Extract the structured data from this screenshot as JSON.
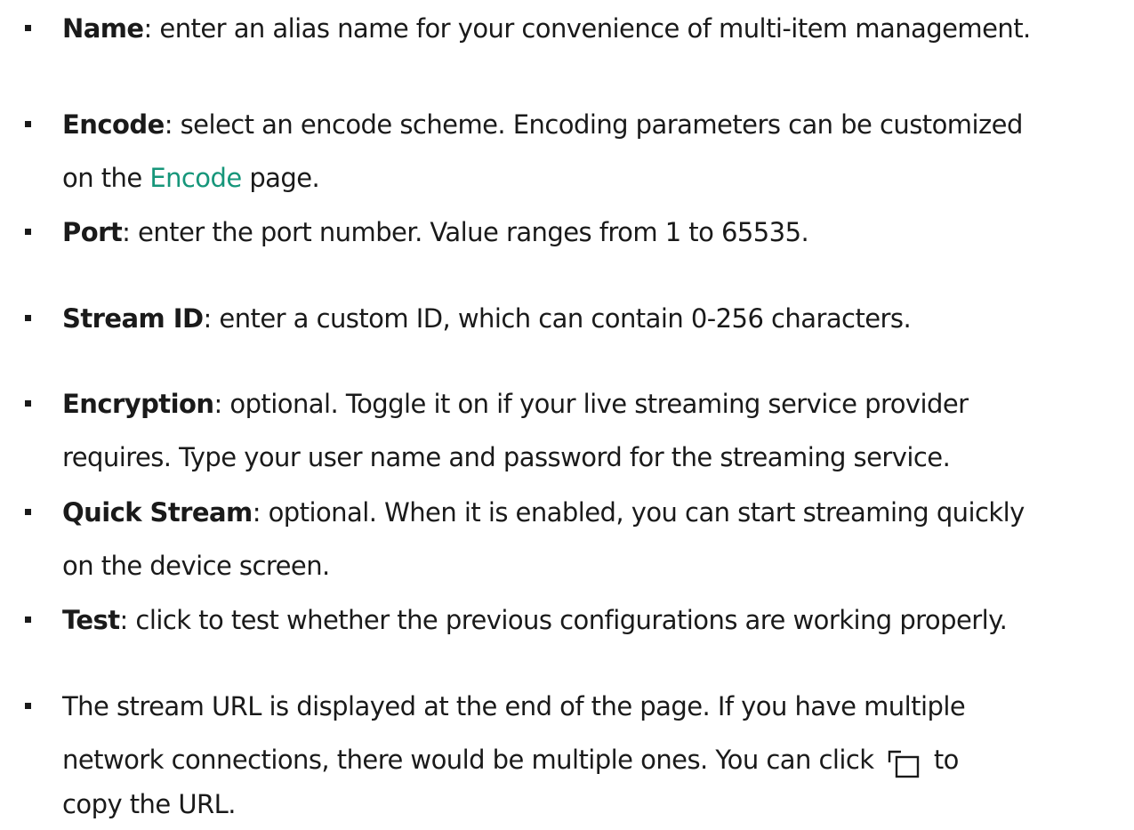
{
  "items": [
    {
      "term": "Name",
      "text": ": enter an alias name for your convenience of multi-item management."
    },
    {
      "term": "Encode",
      "text_line1": ": select an encode scheme. Encoding parameters can be customized",
      "text_before_link": "on the ",
      "link": "Encode",
      "text_after_link": " page."
    },
    {
      "term": "Port",
      "text": ": enter the port number. Value ranges from 1 to 65535."
    },
    {
      "term": "Stream ID",
      "text": ": enter a custom ID, which can contain 0-256 characters."
    },
    {
      "term": "Encryption",
      "text_line1": ": optional. Toggle it on if your live streaming service provider",
      "text_line2": "requires. Type your user name and password for the streaming service."
    },
    {
      "term": "Quick Stream",
      "text_line1": ": optional. When it is enabled, you can start streaming quickly",
      "text_line2": "on the device screen."
    },
    {
      "term": "Test",
      "text": ": click to test whether the previous configurations are working properly."
    },
    {
      "text_line1": "The stream URL is displayed at the end of the page. If you have multiple",
      "text_line2_before_icon": "network connections, there would be multiple ones. You can click ",
      "icon": "copy-icon",
      "text_line2_after_icon": " to",
      "text_line3": "copy the URL."
    }
  ]
}
